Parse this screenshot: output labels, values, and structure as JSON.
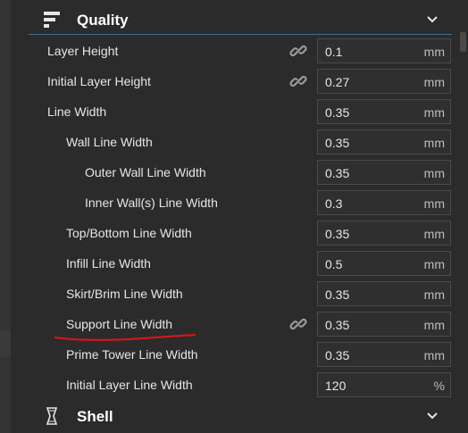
{
  "sections": {
    "quality": {
      "title": "Quality",
      "icon": "quality-icon"
    },
    "shell": {
      "title": "Shell",
      "icon": "shell-icon"
    }
  },
  "settings": [
    {
      "label": "Layer Height",
      "value": "0.1",
      "unit": "mm",
      "linked": true,
      "indent": 0
    },
    {
      "label": "Initial Layer Height",
      "value": "0.27",
      "unit": "mm",
      "linked": true,
      "indent": 0
    },
    {
      "label": "Line Width",
      "value": "0.35",
      "unit": "mm",
      "linked": false,
      "indent": 0
    },
    {
      "label": "Wall Line Width",
      "value": "0.35",
      "unit": "mm",
      "linked": false,
      "indent": 1
    },
    {
      "label": "Outer Wall Line Width",
      "value": "0.35",
      "unit": "mm",
      "linked": false,
      "indent": 2
    },
    {
      "label": "Inner Wall(s) Line Width",
      "value": "0.3",
      "unit": "mm",
      "linked": false,
      "indent": 2
    },
    {
      "label": "Top/Bottom Line Width",
      "value": "0.35",
      "unit": "mm",
      "linked": false,
      "indent": 1
    },
    {
      "label": "Infill Line Width",
      "value": "0.5",
      "unit": "mm",
      "linked": false,
      "indent": 1
    },
    {
      "label": "Skirt/Brim Line Width",
      "value": "0.35",
      "unit": "mm",
      "linked": false,
      "indent": 1
    },
    {
      "label": "Support Line Width",
      "value": "0.35",
      "unit": "mm",
      "linked": true,
      "indent": 1
    },
    {
      "label": "Prime Tower Line Width",
      "value": "0.35",
      "unit": "mm",
      "linked": false,
      "indent": 1
    },
    {
      "label": "Initial Layer Line Width",
      "value": "120",
      "unit": "%",
      "linked": false,
      "indent": 1
    }
  ],
  "colors": {
    "accent_divider": "#3b6f96",
    "annotation": "#d01818"
  }
}
